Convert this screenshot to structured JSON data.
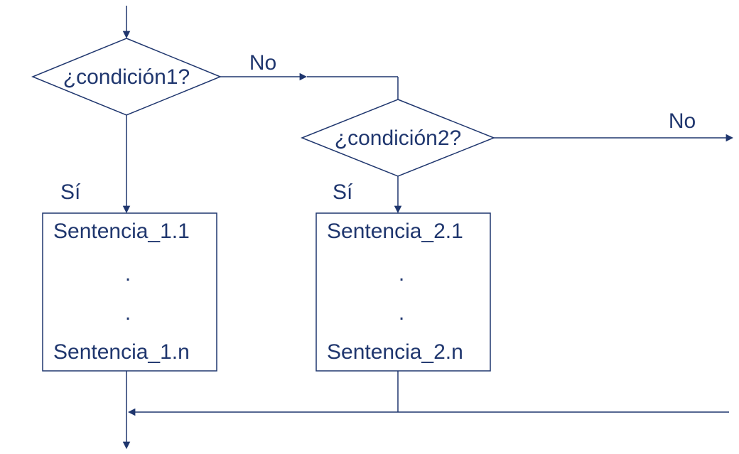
{
  "diagram": {
    "decision1": {
      "label": "¿condición1?"
    },
    "decision2": {
      "label": "¿condición2?"
    },
    "branch_no1": "No",
    "branch_no2": "No",
    "branch_yes1": "Sí",
    "branch_yes2": "Sí",
    "block1": {
      "line1": "Sentencia_1.1",
      "dot1": ".",
      "dot2": ".",
      "line2": "Sentencia_1.n"
    },
    "block2": {
      "line1": "Sentencia_2.1",
      "dot1": ".",
      "dot2": ".",
      "line2": "Sentencia_2.n"
    }
  }
}
